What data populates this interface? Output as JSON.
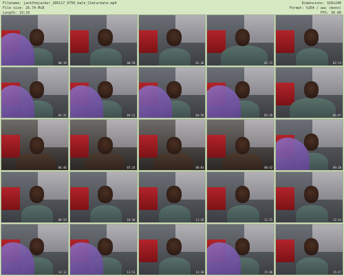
{
  "header": {
    "filename": "Filename: jackthejacker_280117_0756_male_Chaturbate.mp4",
    "filesize": "File size: 26.74 MiB",
    "length": "Length: 19:10",
    "dimensions": "Dimensions: 320x240",
    "format": "Format: h264 / aac (mono)",
    "fps": "FPS: 30.00"
  },
  "thumbnails": [
    {
      "timestamp": "00:19"
    },
    {
      "timestamp": "00:58"
    },
    {
      "timestamp": "01:36"
    },
    {
      "timestamp": "02:15"
    },
    {
      "timestamp": "02:54"
    },
    {
      "timestamp": "03:32"
    },
    {
      "timestamp": "04:11"
    },
    {
      "timestamp": "04:50"
    },
    {
      "timestamp": "05:28"
    },
    {
      "timestamp": "06:07"
    },
    {
      "timestamp": "06:46"
    },
    {
      "timestamp": "07:24"
    },
    {
      "timestamp": "08:03"
    },
    {
      "timestamp": "08:42"
    },
    {
      "timestamp": "09:20"
    },
    {
      "timestamp": "09:59"
    },
    {
      "timestamp": "10:38"
    },
    {
      "timestamp": "11:16"
    },
    {
      "timestamp": "11:55"
    },
    {
      "timestamp": "12:34"
    },
    {
      "timestamp": "13:12"
    },
    {
      "timestamp": "13:51"
    },
    {
      "timestamp": "14:30"
    },
    {
      "timestamp": "15:08"
    },
    {
      "timestamp": "15:47"
    }
  ],
  "colors": {
    "background": "#d7e9c3",
    "drape": "#7a58b0",
    "wall_red": "#b2242a"
  }
}
